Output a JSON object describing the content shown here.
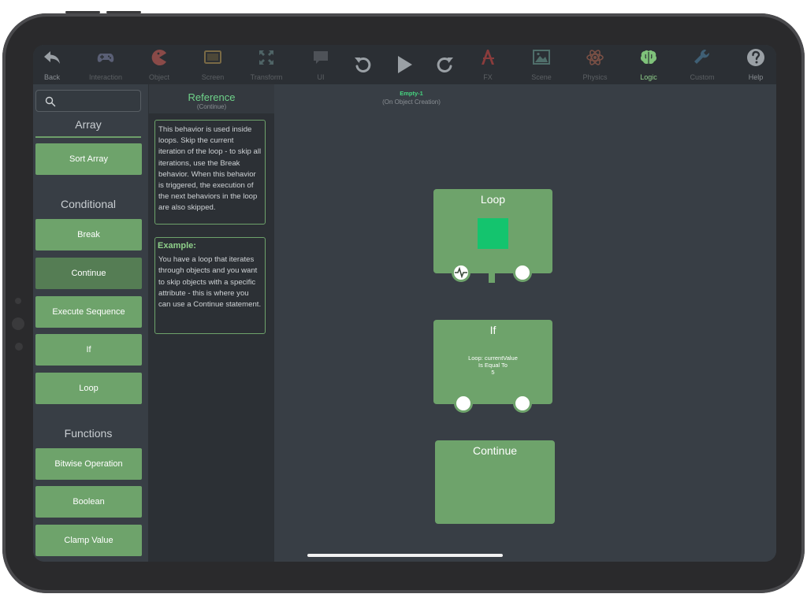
{
  "toolbar": {
    "items": [
      {
        "label": "Back",
        "icon": "back-arrow-icon"
      },
      {
        "label": "Interaction",
        "icon": "gamepad-icon"
      },
      {
        "label": "Object",
        "icon": "pacman-icon"
      },
      {
        "label": "Screen",
        "icon": "screen-icon"
      },
      {
        "label": "Transform",
        "icon": "transform-icon"
      },
      {
        "label": "UI",
        "icon": "chat-bubble-icon"
      },
      {
        "label": "FX",
        "icon": "fx-icon"
      },
      {
        "label": "Scene",
        "icon": "scene-image-icon"
      },
      {
        "label": "Physics",
        "icon": "atom-icon"
      },
      {
        "label": "Logic",
        "icon": "brain-icon"
      },
      {
        "label": "Custom",
        "icon": "wrench-icon"
      },
      {
        "label": "Help",
        "icon": "help-icon"
      }
    ],
    "active": "Logic",
    "center": [
      "undo-icon",
      "play-icon",
      "redo-icon"
    ]
  },
  "sidebar": {
    "search_placeholder": "",
    "sections": [
      {
        "title": "Array",
        "items": [
          "Sort Array"
        ]
      },
      {
        "title": "Conditional",
        "items": [
          "Break",
          "Continue",
          "Execute Sequence",
          "If",
          "Loop"
        ]
      },
      {
        "title": "Functions",
        "items": [
          "Bitwise Operation",
          "Boolean",
          "Clamp Value"
        ]
      }
    ],
    "selected": "Continue"
  },
  "reference": {
    "title": "Reference",
    "subtitle": "(Continue)",
    "description": "This behavior is used inside loops. Skip the current iteration of the loop - to skip all iterations, use the Break behavior. When this behavior is triggered, the execution of the next behaviors in the loop are also skipped.",
    "example_title": "Example:",
    "example_text": "You have a loop that iterates through objects and you want to skip objects with a specific attribute - this is where you can use a Continue statement."
  },
  "canvas": {
    "object_name": "Empty-1",
    "event": "(On Object Creation)",
    "nodes": {
      "loop": {
        "title": "Loop"
      },
      "if": {
        "title": "If",
        "line1": "Loop: currentValue",
        "line2": "Is Equal To",
        "line3": "5"
      },
      "continue": {
        "title": "Continue"
      }
    }
  },
  "colors": {
    "accent": "#6ea36b",
    "accent_dark": "#557d54",
    "highlight": "#6fd38a",
    "loop_square": "#14c46e",
    "background": "#383e45"
  }
}
